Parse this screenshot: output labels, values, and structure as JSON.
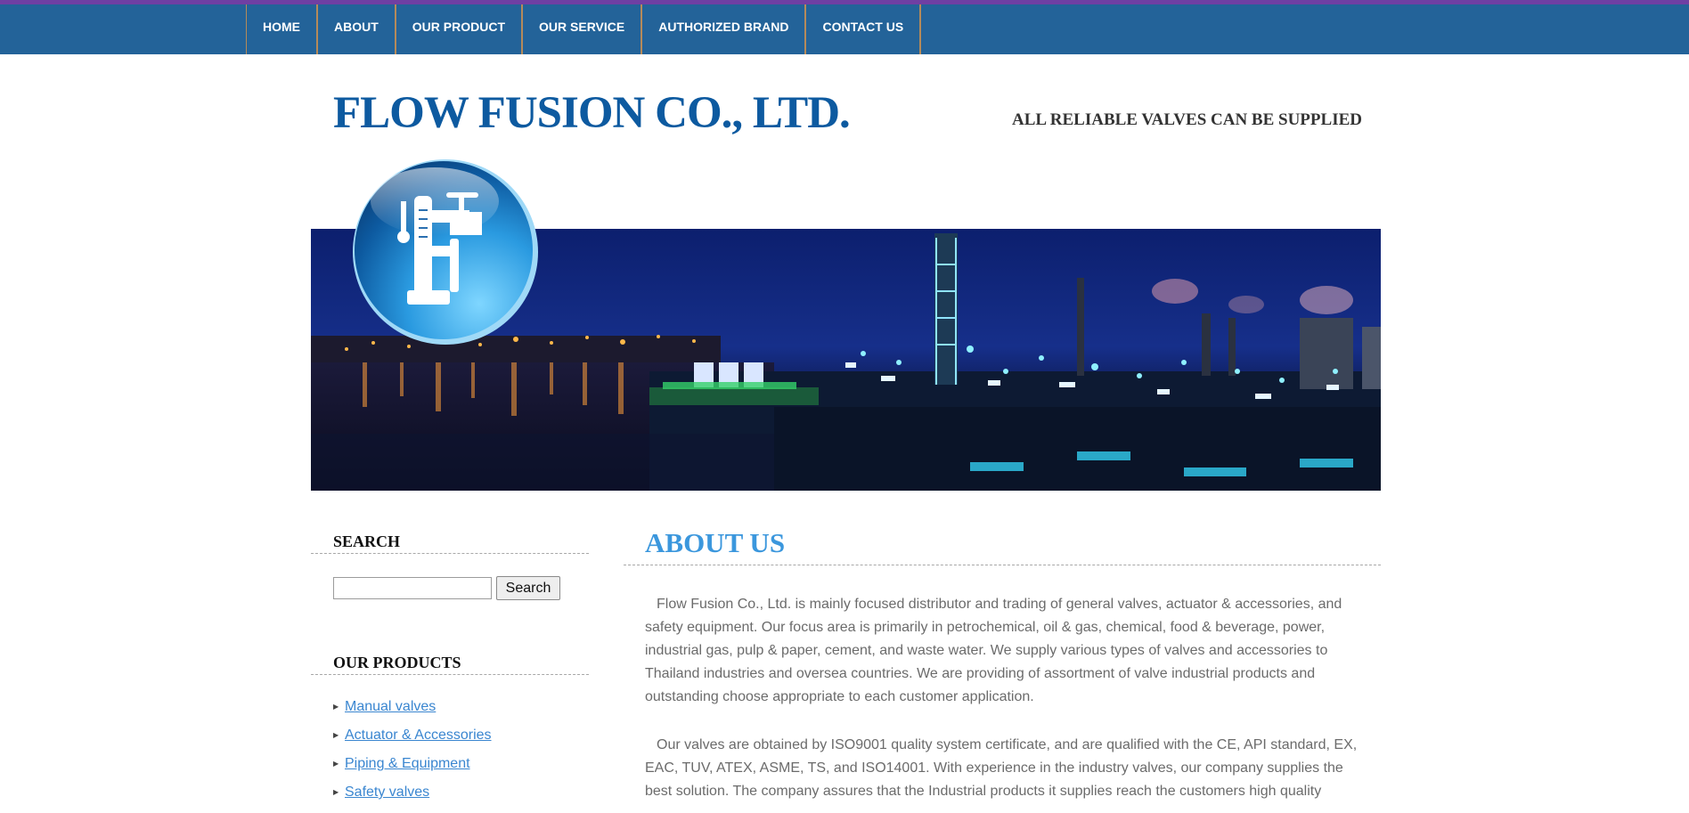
{
  "nav": {
    "items": [
      "HOME",
      "ABOUT",
      "OUR PRODUCT",
      "OUR SERVICE",
      "AUTHORIZED BRAND",
      "CONTACT US"
    ]
  },
  "header": {
    "company_name": "FLOW FUSION CO., LTD.",
    "tagline": "ALL RELIABLE VALVES CAN BE SUPPLIED"
  },
  "sidebar": {
    "search_title": "SEARCH",
    "search_value": "",
    "search_button": "Search",
    "products_title": "OUR PRODUCTS",
    "products": [
      "Manual valves",
      "Actuator & Accessories",
      "Piping & Equipment",
      "Safety valves"
    ]
  },
  "main": {
    "title": "ABOUT US",
    "paragraphs": [
      "Flow Fusion Co., Ltd. is mainly focused distributor and trading of general valves, actuator & accessories, and safety equipment. Our focus area is primarily in petrochemical, oil & gas, chemical, food & beverage, power, industrial gas, pulp & paper, cement, and waste water. We supply various types of valves and accessories to Thailand industries and oversea countries. We are providing of assortment of valve industrial products and outstanding choose appropriate to each customer application.",
      "Our valves are obtained by ISO9001 quality system certificate, and are qualified with the CE, API standard, EX, EAC, TUV, ATEX, ASME, TS, and ISO14001. With experience in the industry valves, our company supplies the best solution. The company assures that the Industrial products it supplies reach the customers high quality"
    ]
  },
  "colors": {
    "top_strip": "#6f3fa3",
    "nav_bg": "#236399",
    "nav_divider": "#b58a5a",
    "logo_blue": "#0d5aa0",
    "about_title": "#3b97dd",
    "link": "#3a86d0",
    "body_text": "#6b6b6b"
  },
  "icons": {
    "logo_emblem": "valve-emblem-icon",
    "list_bullet": "triangle-bullet-icon"
  }
}
